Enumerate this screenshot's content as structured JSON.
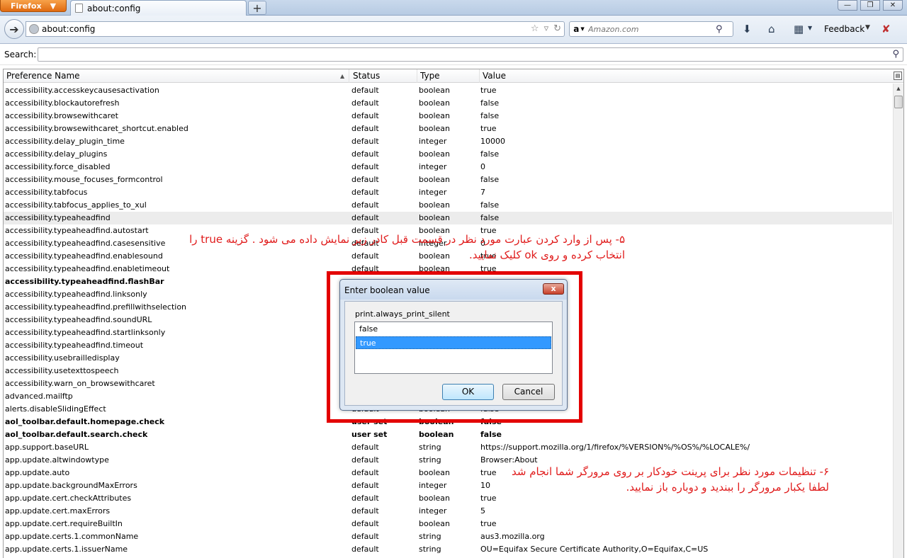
{
  "window": {
    "firefox_label": "Firefox",
    "tab_title": "about:config",
    "new_tab_label": "+",
    "minimize": "—",
    "maximize": "❐",
    "close": "✕"
  },
  "navbar": {
    "url": "about:config",
    "search_engine": "a",
    "search_placeholder": "Amazon.com",
    "feedback_label": "Feedback"
  },
  "filter": {
    "label": "Search:",
    "value": ""
  },
  "tree": {
    "columns": [
      "Preference Name",
      "Status",
      "Type",
      "Value"
    ],
    "rows": [
      {
        "name": "accessibility.accesskeycausesactivation",
        "status": "default",
        "type": "boolean",
        "value": "true"
      },
      {
        "name": "accessibility.blockautorefresh",
        "status": "default",
        "type": "boolean",
        "value": "false"
      },
      {
        "name": "accessibility.browsewithcaret",
        "status": "default",
        "type": "boolean",
        "value": "false"
      },
      {
        "name": "accessibility.browsewithcaret_shortcut.enabled",
        "status": "default",
        "type": "boolean",
        "value": "true"
      },
      {
        "name": "accessibility.delay_plugin_time",
        "status": "default",
        "type": "integer",
        "value": "10000"
      },
      {
        "name": "accessibility.delay_plugins",
        "status": "default",
        "type": "boolean",
        "value": "false"
      },
      {
        "name": "accessibility.force_disabled",
        "status": "default",
        "type": "integer",
        "value": "0"
      },
      {
        "name": "accessibility.mouse_focuses_formcontrol",
        "status": "default",
        "type": "boolean",
        "value": "false"
      },
      {
        "name": "accessibility.tabfocus",
        "status": "default",
        "type": "integer",
        "value": "7"
      },
      {
        "name": "accessibility.tabfocus_applies_to_xul",
        "status": "default",
        "type": "boolean",
        "value": "false"
      },
      {
        "name": "accessibility.typeaheadfind",
        "status": "default",
        "type": "boolean",
        "value": "false",
        "selected": true
      },
      {
        "name": "accessibility.typeaheadfind.autostart",
        "status": "default",
        "type": "boolean",
        "value": "true"
      },
      {
        "name": "accessibility.typeaheadfind.casesensitive",
        "status": "default",
        "type": "integer",
        "value": "0"
      },
      {
        "name": "accessibility.typeaheadfind.enablesound",
        "status": "default",
        "type": "boolean",
        "value": "true"
      },
      {
        "name": "accessibility.typeaheadfind.enabletimeout",
        "status": "default",
        "type": "boolean",
        "value": "true"
      },
      {
        "name": "accessibility.typeaheadfind.flashBar",
        "status": "",
        "type": "",
        "value": "",
        "bold": true
      },
      {
        "name": "accessibility.typeaheadfind.linksonly",
        "status": "",
        "type": "",
        "value": ""
      },
      {
        "name": "accessibility.typeaheadfind.prefillwithselection",
        "status": "",
        "type": "",
        "value": ""
      },
      {
        "name": "accessibility.typeaheadfind.soundURL",
        "status": "",
        "type": "",
        "value": ""
      },
      {
        "name": "accessibility.typeaheadfind.startlinksonly",
        "status": "",
        "type": "",
        "value": ""
      },
      {
        "name": "accessibility.typeaheadfind.timeout",
        "status": "",
        "type": "",
        "value": ""
      },
      {
        "name": "accessibility.usebrailledisplay",
        "status": "",
        "type": "",
        "value": ""
      },
      {
        "name": "accessibility.usetexttospeech",
        "status": "",
        "type": "",
        "value": ""
      },
      {
        "name": "accessibility.warn_on_browsewithcaret",
        "status": "",
        "type": "",
        "value": ""
      },
      {
        "name": "advanced.mailftp",
        "status": "",
        "type": "",
        "value": ""
      },
      {
        "name": "alerts.disableSlidingEffect",
        "status": "default",
        "type": "boolean",
        "value": "false"
      },
      {
        "name": "aol_toolbar.default.homepage.check",
        "status": "user set",
        "type": "boolean",
        "value": "false",
        "bold": true
      },
      {
        "name": "aol_toolbar.default.search.check",
        "status": "user set",
        "type": "boolean",
        "value": "false",
        "bold": true
      },
      {
        "name": "app.support.baseURL",
        "status": "default",
        "type": "string",
        "value": "https://support.mozilla.org/1/firefox/%VERSION%/%OS%/%LOCALE%/"
      },
      {
        "name": "app.update.altwindowtype",
        "status": "default",
        "type": "string",
        "value": "Browser:About"
      },
      {
        "name": "app.update.auto",
        "status": "default",
        "type": "boolean",
        "value": "true"
      },
      {
        "name": "app.update.backgroundMaxErrors",
        "status": "default",
        "type": "integer",
        "value": "10"
      },
      {
        "name": "app.update.cert.checkAttributes",
        "status": "default",
        "type": "boolean",
        "value": "true"
      },
      {
        "name": "app.update.cert.maxErrors",
        "status": "default",
        "type": "integer",
        "value": "5"
      },
      {
        "name": "app.update.cert.requireBuiltIn",
        "status": "default",
        "type": "boolean",
        "value": "true"
      },
      {
        "name": "app.update.certs.1.commonName",
        "status": "default",
        "type": "string",
        "value": "aus3.mozilla.org"
      },
      {
        "name": "app.update.certs.1.issuerName",
        "status": "default",
        "type": "string",
        "value": "OU=Equifax Secure Certificate Authority,O=Equifax,C=US"
      }
    ]
  },
  "dialog": {
    "title": "Enter boolean value",
    "close": "x",
    "pref_name": "print.always_print_silent",
    "options": [
      "false",
      "true"
    ],
    "selected_index": 1,
    "ok_label": "OK",
    "cancel_label": "Cancel"
  },
  "annotations": {
    "step5": "۵- پس از وارد کردن عبارت مورد نظر در قسمت قبل کادر زیر نمایش داده می شود . گزینه true را انتخاب کرده و روی ok کلیک نمایید.",
    "step6": "۶- تنظیمات مورد نظر برای پرینت خودکار بر روی مرورگر شما انجام شد لطفا یکبار مرورگر را ببندید و دوباره باز نمایید."
  },
  "colors": {
    "annotation_red": "#e01b1b",
    "highlight_box": "#e30000",
    "selection_blue": "#3399ff"
  }
}
